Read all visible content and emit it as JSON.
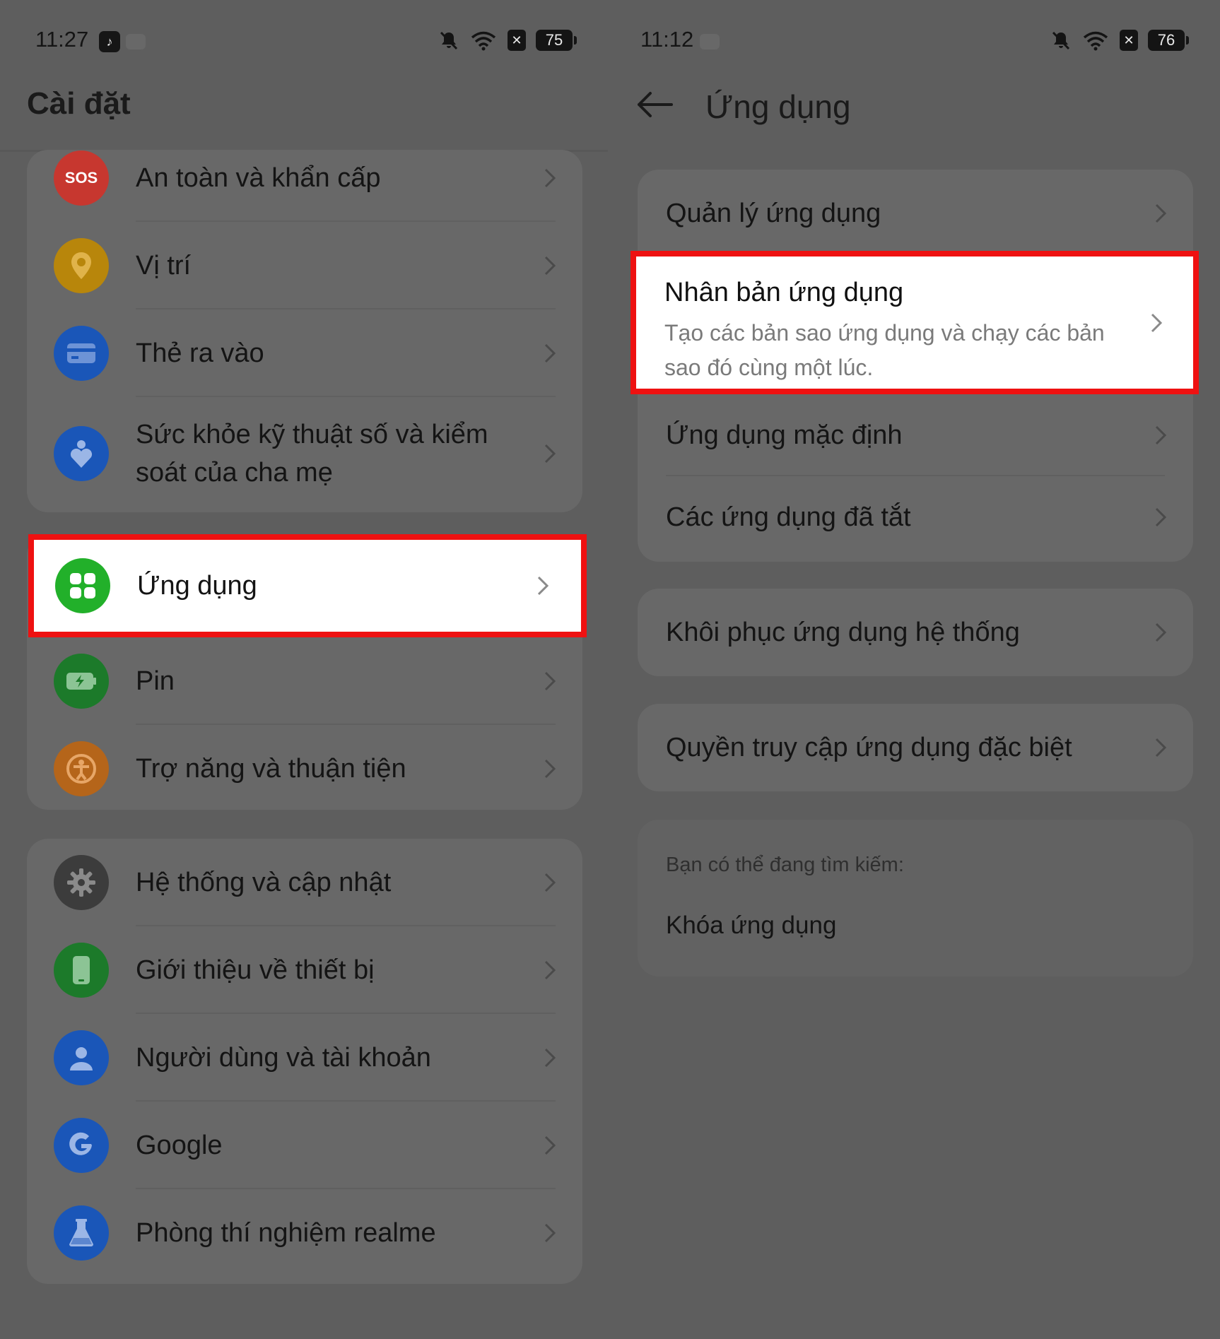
{
  "left": {
    "status": {
      "time": "11:27",
      "app_icon": "tiktok-icon",
      "battery": "75"
    },
    "title": "Cài đặt",
    "groups": [
      {
        "items": [
          {
            "label": "An toàn và khẩn cấp",
            "icon": "sos-icon",
            "icon_text": "SOS",
            "color": "#c7372f"
          },
          {
            "label": "Vị trí",
            "icon": "location-icon",
            "color": "#b8860b"
          },
          {
            "label": "Thẻ ra vào",
            "icon": "card-icon",
            "color": "#1a56b8"
          },
          {
            "label": "Sức khỏe kỹ thuật số và kiểm soát của cha mẹ",
            "icon": "wellbeing-heart-icon",
            "color": "#1a56b8"
          }
        ]
      },
      {
        "items": [
          {
            "label": "Ứng dụng",
            "icon": "apps-grid-icon",
            "color": "#22b02a",
            "highlighted": true
          },
          {
            "label": "Pin",
            "icon": "battery-charging-icon",
            "color": "#1c7a2a"
          },
          {
            "label": "Trợ năng và thuận tiện",
            "icon": "accessibility-icon",
            "color": "#b5651a"
          }
        ]
      },
      {
        "items": [
          {
            "label": "Hệ thống và cập nhật",
            "icon": "gear-icon",
            "color": "#3c3c3c"
          },
          {
            "label": "Giới thiệu về thiết bị",
            "icon": "phone-icon",
            "color": "#1c7a2a"
          },
          {
            "label": "Người dùng và tài khoản",
            "icon": "user-icon",
            "color": "#1a56b8"
          },
          {
            "label": "Google",
            "icon": "google-icon",
            "color": "#1a56b8"
          },
          {
            "label": "Phòng thí nghiệm realme",
            "icon": "lab-flask-icon",
            "color": "#1a56b8"
          }
        ]
      }
    ]
  },
  "right": {
    "status": {
      "time": "11:12",
      "battery": "76"
    },
    "title": "Ứng dụng",
    "items": {
      "manage": "Quản lý ứng dụng",
      "clone_title": "Nhân bản ứng dụng",
      "clone_desc": "Tạo các bản sao ứng dụng và chạy các bản sao đó cùng một lúc.",
      "default": "Ứng dụng mặc định",
      "disabled": "Các ứng dụng đã tắt",
      "restore": "Khôi phục ứng dụng hệ thống",
      "special": "Quyền truy cập ứng dụng đặc biệt"
    },
    "suggest": {
      "heading": "Bạn có thể đang tìm kiếm:",
      "item": "Khóa ứng dụng"
    }
  },
  "colors": {
    "highlight_border": "#ee1111",
    "dim_overlay": "#5e5e5e"
  }
}
